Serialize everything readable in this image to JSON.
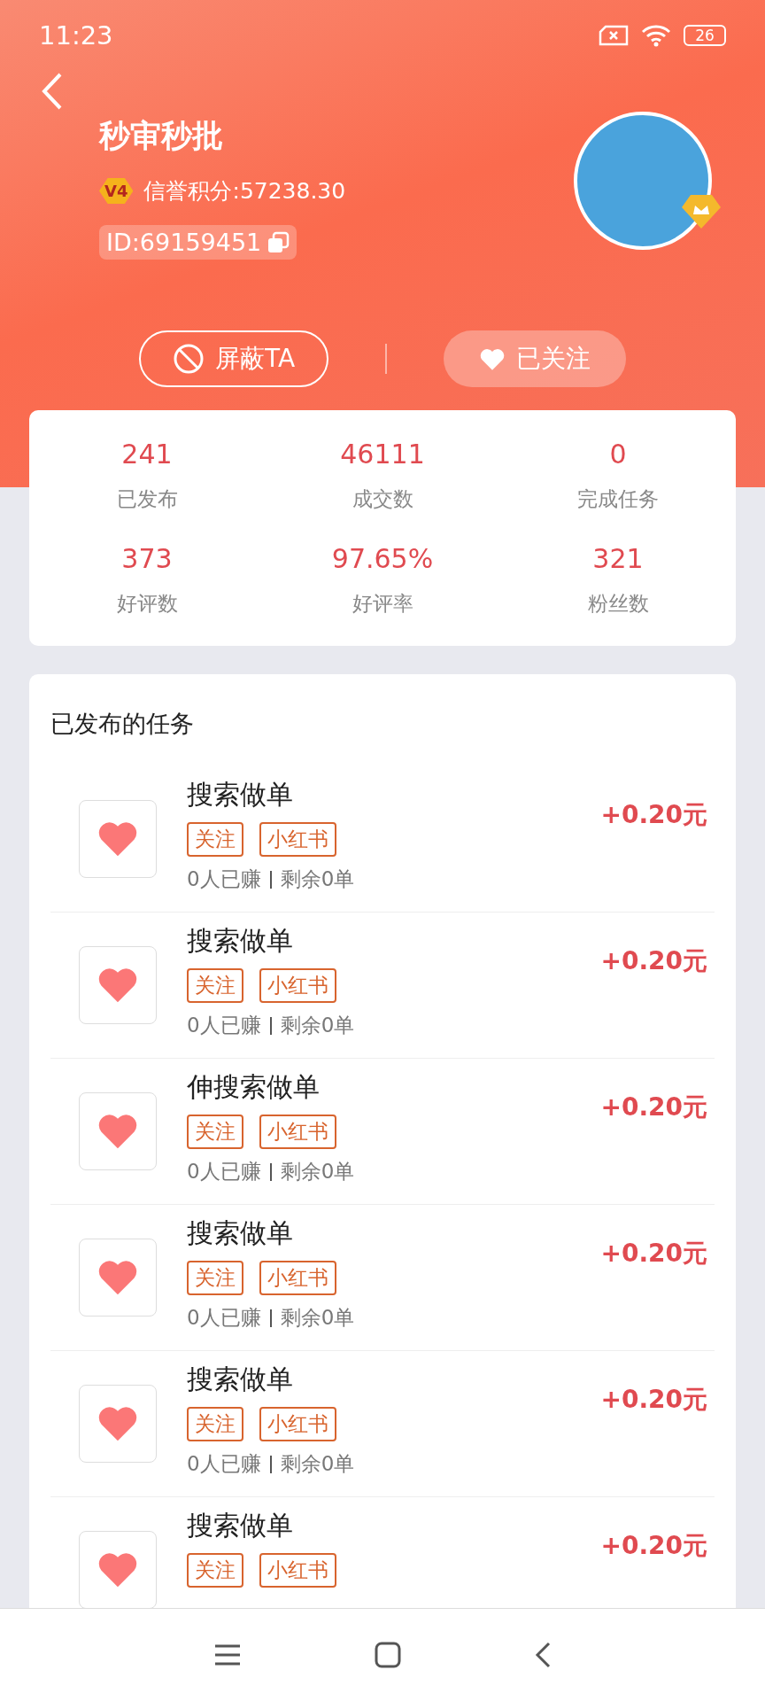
{
  "status_bar": {
    "time": "11:23",
    "battery": "26"
  },
  "profile": {
    "name": "秒审秒批",
    "level_badge": "V4",
    "credit": "信誉积分:57238.30",
    "id": "ID:69159451"
  },
  "actions": [
    {
      "kind": "block",
      "label": "屏蔽TA",
      "selected": false
    },
    {
      "kind": "follow",
      "label": "已关注",
      "selected": true
    }
  ],
  "stats": [
    {
      "value": "241",
      "label": "已发布"
    },
    {
      "value": "46111",
      "label": "成交数"
    },
    {
      "value": "0",
      "label": "完成任务"
    },
    {
      "value": "373",
      "label": "好评数"
    },
    {
      "value": "97.65%",
      "label": "好评率"
    },
    {
      "value": "321",
      "label": "粉丝数"
    }
  ],
  "tasks_section": {
    "title": "已发布的任务",
    "items": [
      {
        "title": "搜索做单",
        "tags": [
          "关注",
          "小红书"
        ],
        "earned": "0人已赚",
        "remaining": "剩余0单",
        "price": "+0.20元"
      },
      {
        "title": "搜索做单",
        "tags": [
          "关注",
          "小红书"
        ],
        "earned": "0人已赚",
        "remaining": "剩余0单",
        "price": "+0.20元"
      },
      {
        "title": "伸搜索做单",
        "tags": [
          "关注",
          "小红书"
        ],
        "earned": "0人已赚",
        "remaining": "剩余0单",
        "price": "+0.20元"
      },
      {
        "title": "搜索做单",
        "tags": [
          "关注",
          "小红书"
        ],
        "earned": "0人已赚",
        "remaining": "剩余0单",
        "price": "+0.20元"
      },
      {
        "title": "搜索做单",
        "tags": [
          "关注",
          "小红书"
        ],
        "earned": "0人已赚",
        "remaining": "剩余0单",
        "price": "+0.20元"
      },
      {
        "title": "搜索做单",
        "tags": [
          "关注",
          "小红书"
        ],
        "price": "+0.20元"
      }
    ]
  }
}
